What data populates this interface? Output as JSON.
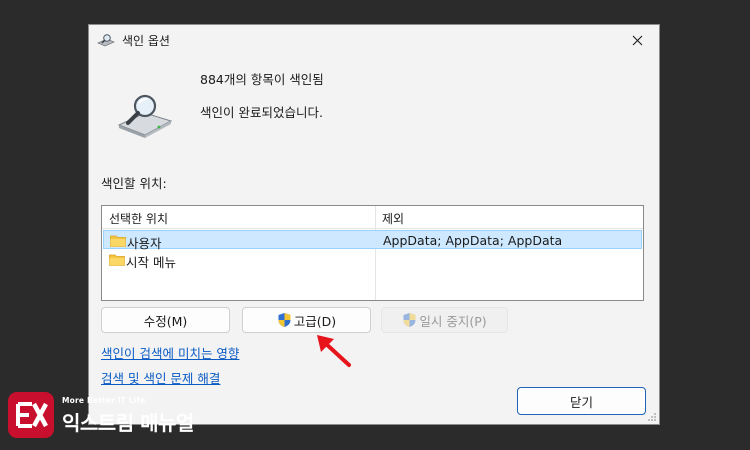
{
  "dialog": {
    "title": "색인 옵션",
    "icons": {
      "title": "indexing-options-icon",
      "main": "drive-magnifier-icon",
      "close": "close-icon"
    }
  },
  "status": {
    "indexed_count": "884개의 항목이 색인됨",
    "message": "색인이 완료되었습니다."
  },
  "locations": {
    "label": "색인할 위치:",
    "columns": [
      "선택한 위치",
      "제외"
    ],
    "rows": [
      {
        "location": "사용자",
        "exclude": "AppData; AppData; AppData",
        "selected": true,
        "icon": "folder-icon"
      },
      {
        "location": "시작 메뉴",
        "exclude": "",
        "selected": false,
        "icon": "folder-icon"
      }
    ]
  },
  "buttons": {
    "modify": "수정(M)",
    "advanced": "고급(D)",
    "pause": "일시 중지(P)",
    "close": "닫기"
  },
  "links": {
    "affects": "색인이 검색에 미치는 영향",
    "troubleshoot": "검색 및 색인 문제 해결"
  },
  "watermark": {
    "tagline": "More Better IT Life",
    "name": "익스트림 매뉴얼"
  },
  "colors": {
    "selection": "#cde8ff",
    "link": "#0a5bc4",
    "arrow": "#e8141b",
    "brand": "#c8102e"
  }
}
